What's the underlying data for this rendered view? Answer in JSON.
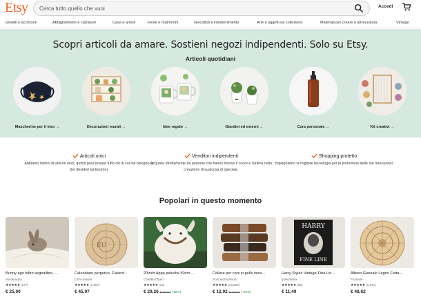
{
  "header": {
    "logo": "Etsy",
    "search_placeholder": "Cerca tutto quello che vuoi",
    "signin_label": "Accedi",
    "search_icon": "search-icon",
    "cart_icon": "cart-icon",
    "brand_color": "#f1641e"
  },
  "categories_nav": [
    "Gioielli e accessori",
    "Abbigliamento e calzature",
    "Casa e arredi",
    "Feste e matrimoni",
    "Giocattoli e intrattenimento",
    "Arte e oggetti da collezione",
    "Materiali per creare e attrezzatura",
    "Vintage"
  ],
  "hero": {
    "title": "Scopri articoli da amare. Sostieni negozi indipendenti. Solo su Etsy.",
    "subtitle": "Articoli quotidiani",
    "background_color": "#d6e9e0",
    "items": [
      {
        "label": "Mascherine per il viso →"
      },
      {
        "label": "Decorazioni murali →"
      },
      {
        "label": "Idee regalo →"
      },
      {
        "label": "Giardini ed esterni →"
      },
      {
        "label": "Cura personale →"
      },
      {
        "label": "Kit creativi →"
      }
    ]
  },
  "value_props": [
    {
      "title": "Articoli unici",
      "description": "Abbiamo milioni di articoli unici, quindi puoi trovare tutto ciò di cui hai bisogno (o che desideri tantissimo)."
    },
    {
      "title": "Venditori indipendenti",
      "description": "Acquista direttamente da persone che hanno messo il cuore e l'anima nella creazione di qualcosa di speciale."
    },
    {
      "title": "Shopping protetto",
      "description": "Impieghiamo la migliore tecnologia per la protezione delle tue transazioni."
    }
  ],
  "popular": {
    "title": "Popolari in questo momento",
    "products": [
      {
        "title": "Bunny ago feltro segnalibro, ...",
        "shop": "dondinadya",
        "stars": "★★★★★",
        "count": "(277)",
        "price": "€ 25,00",
        "orig_price": "",
        "discount": ""
      },
      {
        "title": "Calendario perpetuo, Calend...",
        "shop": "CSAcreative",
        "stars": "★★★★★",
        "count": "(1.507)",
        "price": "€ 45,97",
        "orig_price": "",
        "discount": ""
      },
      {
        "title": "20inch Appa peluche 50cm ...",
        "shop": "CharlBuChairi",
        "stars": "★★★★★",
        "count": "(13)",
        "price": "€ 29,26",
        "orig_price": "€ 32,51",
        "discount": "(10%)"
      },
      {
        "title": "Collare per cani in pelle inois...",
        "shop": "SoGoodSoWood",
        "stars": "★★★★★",
        "count": "(14.803)",
        "price": "€ 12,92",
        "orig_price": "€ 17,24",
        "discount": "(-25%)"
      },
      {
        "title": "Harry Styles Vintage Fine Lin...",
        "shop": "tpwkshirtex",
        "stars": "★★★★★",
        "count": "(86)",
        "price": "€ 11,49",
        "orig_price": "",
        "discount": ""
      },
      {
        "title": "Albero Genealo Legno Fetta ...",
        "shop": "Foxbaim",
        "stars": "★★★★★",
        "count": "(1.671)",
        "price": "€ 48,62",
        "orig_price": "",
        "discount": ""
      }
    ]
  }
}
